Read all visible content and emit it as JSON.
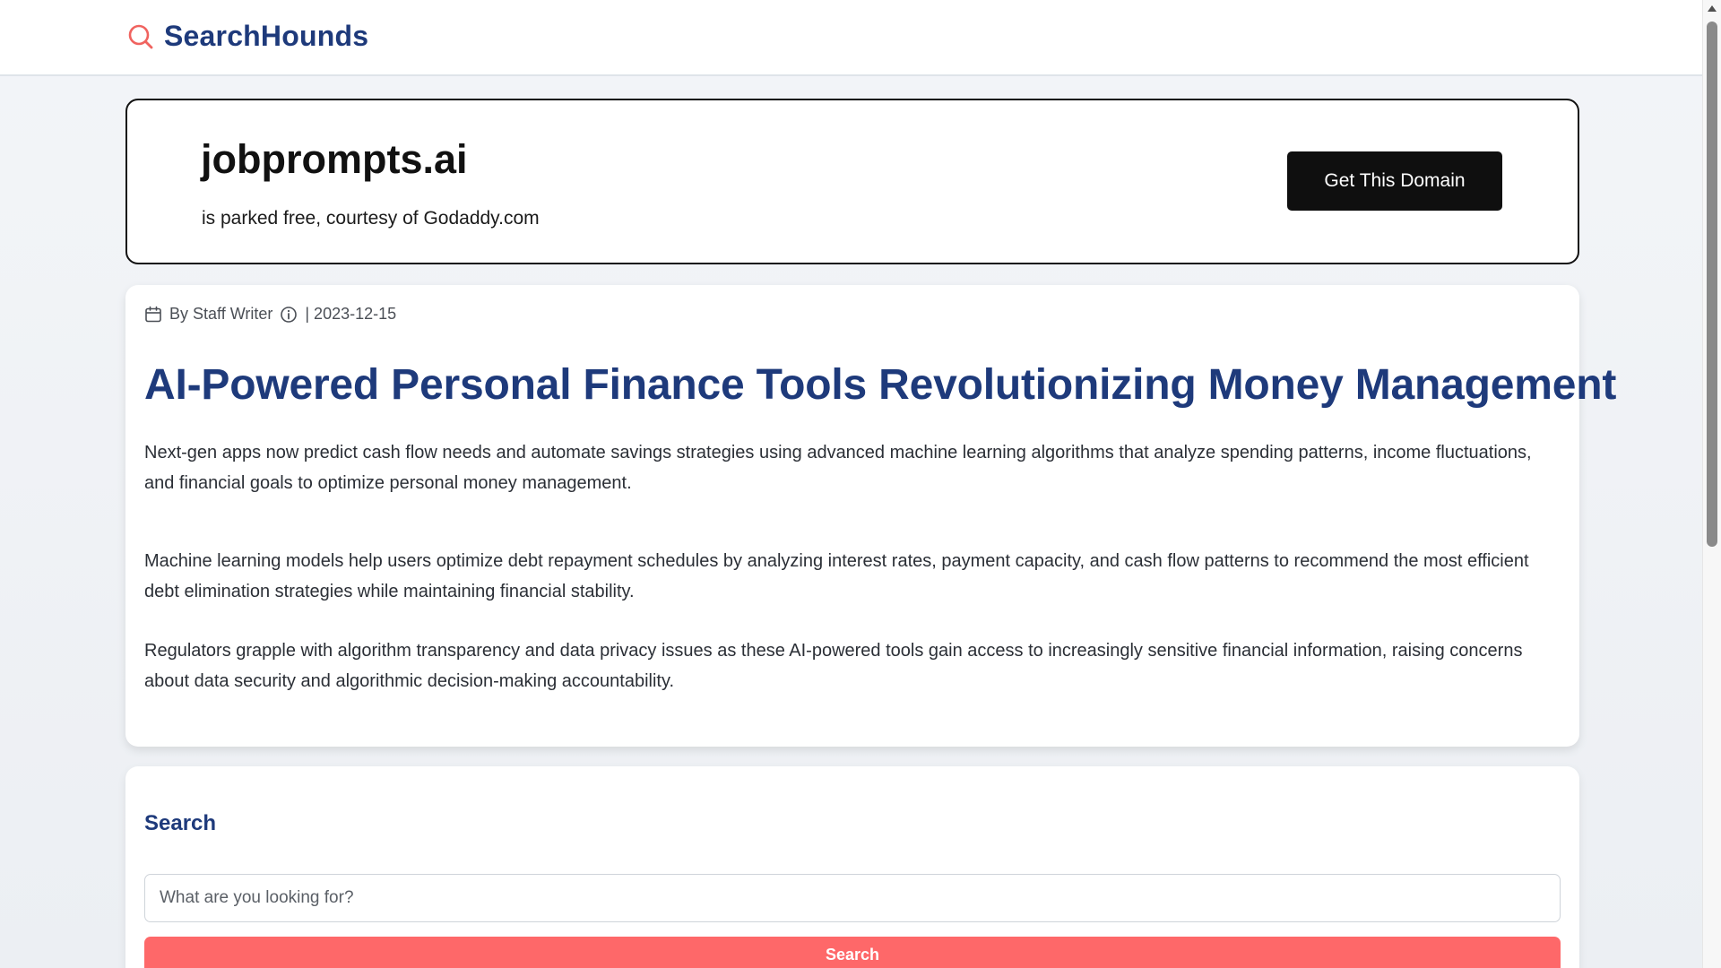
{
  "header": {
    "brand_name": "SearchHounds",
    "brand_icon": "search-icon",
    "brand_icon_color": "#f0635f",
    "brand_color": "#1e3a7b"
  },
  "domain_banner": {
    "domain": "jobprompts.ai",
    "subtitle": "is parked free, courtesy of Godaddy.com",
    "cta_label": "Get This Domain"
  },
  "article": {
    "meta_icon": "calendar-icon",
    "author": "By Staff Writer",
    "info_icon": "info-icon",
    "date": "| 2023-12-15",
    "headline": "AI-Powered Personal Finance Tools Revolutionizing Money Management",
    "paragraphs": [
      "Next-gen apps now predict cash flow needs and automate savings strategies using advanced machine learning algorithms that analyze spending patterns, income fluctuations, and financial goals to optimize personal money management.",
      "Machine learning models help users optimize debt repayment schedules by analyzing interest rates, payment capacity, and cash flow patterns to recommend the most efficient debt elimination strategies while maintaining financial stability.",
      "Regulators grapple with algorithm transparency and data privacy issues as these AI-powered tools gain access to increasingly sensitive financial information, raising concerns about data security and algorithmic decision-making accountability."
    ]
  },
  "search": {
    "title": "Search",
    "placeholder": "What are you looking for?",
    "button_label": "Search",
    "button_color": "#fe6869"
  }
}
